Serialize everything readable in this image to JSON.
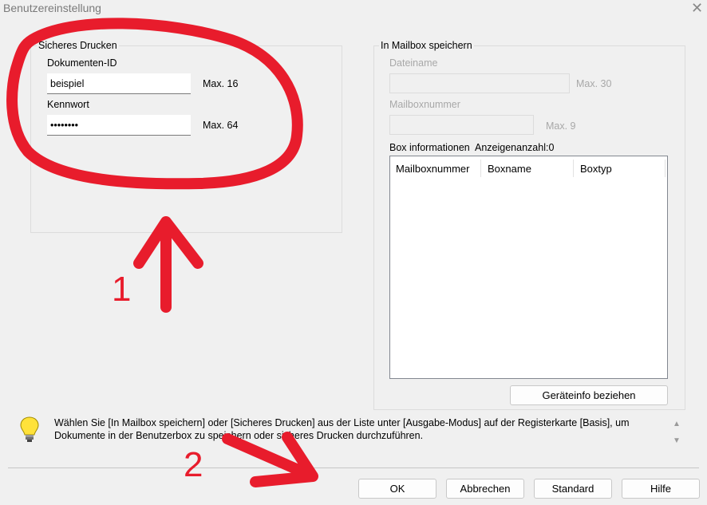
{
  "window": {
    "title": "Benutzereinstellung",
    "close_glyph": "✕"
  },
  "secure_print": {
    "legend": "Sicheres Drucken",
    "doc_id_label": "Dokumenten-ID",
    "doc_id_value": "beispiel",
    "doc_id_max": "Max. 16",
    "password_label": "Kennwort",
    "password_value": "••••••••",
    "password_max": "Max. 64"
  },
  "mailbox": {
    "legend": "In Mailbox speichern",
    "filename_label": "Dateiname",
    "filename_value": "",
    "filename_max": "Max. 30",
    "boxnumber_label": "Mailboxnummer",
    "boxnumber_value": "",
    "boxnumber_max": "Max. 9",
    "box_info_label": "Box informationen  Anzeigenanzahl:0",
    "columns": [
      "Mailboxnummer",
      "Boxname",
      "Boxtyp"
    ],
    "rows": [],
    "fetch_button": "Geräteinfo beziehen"
  },
  "hint": {
    "icon": "lightbulb-icon",
    "text": "Wählen Sie [In Mailbox speichern] oder [Sicheres Drucken] aus der Liste unter [Ausgabe-Modus] auf der Registerkarte [Basis], um Dokumente in der Benutzerbox zu speichern oder sicheres Drucken durchzuführen.",
    "scroll_up": "▲",
    "scroll_down": "▼"
  },
  "buttons": {
    "ok": "OK",
    "cancel": "Abbrechen",
    "default": "Standard",
    "help": "Hilfe"
  },
  "annotations": {
    "number_1": "1",
    "number_2": "2",
    "color": "#e81c2c"
  }
}
